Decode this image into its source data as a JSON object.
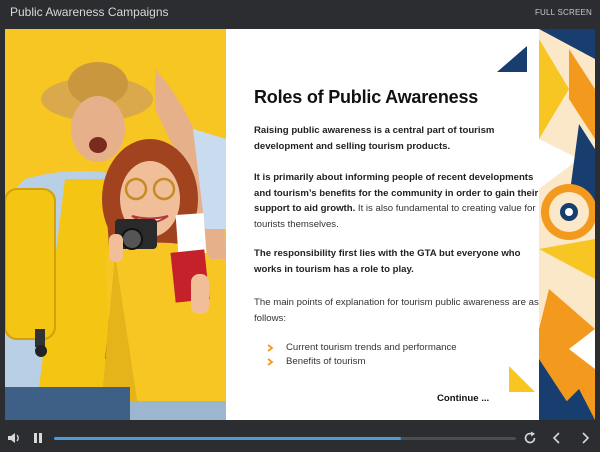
{
  "app": {
    "title": "Public Awareness Campaigns",
    "fullscreen_label": "FULL SCREEN"
  },
  "slide": {
    "heading": "Roles of Public Awareness",
    "para1": "Raising public awareness is a central part of tourism development and selling tourism products.",
    "para2_bold": "It is primarily about informing people of recent developments and tourism’s benefits for the community in order to gain their support to aid growth.",
    "para2_rest": " It is also fundamental to creating value for tourists themselves.",
    "para3": "The responsibility first lies with the GTA but everyone who works in tourism has a role to play.",
    "para4": "The main points of explanation for tourism public awareness are as follows:",
    "bullets": [
      "Current tourism trends and performance",
      "Benefits of tourism"
    ],
    "continue_label": "Continue ..."
  },
  "player": {
    "progress": 0.75
  },
  "colors": {
    "accent": "#f7c623",
    "orange": "#f39a1e",
    "navy": "#173e6e",
    "progress": "#4f9bd9"
  },
  "icons": {
    "volume": "volume-icon",
    "pause": "pause-icon",
    "replay": "replay-icon",
    "prev": "chevron-left-icon",
    "next": "chevron-right-icon",
    "bullet": "chevron-right-icon"
  }
}
